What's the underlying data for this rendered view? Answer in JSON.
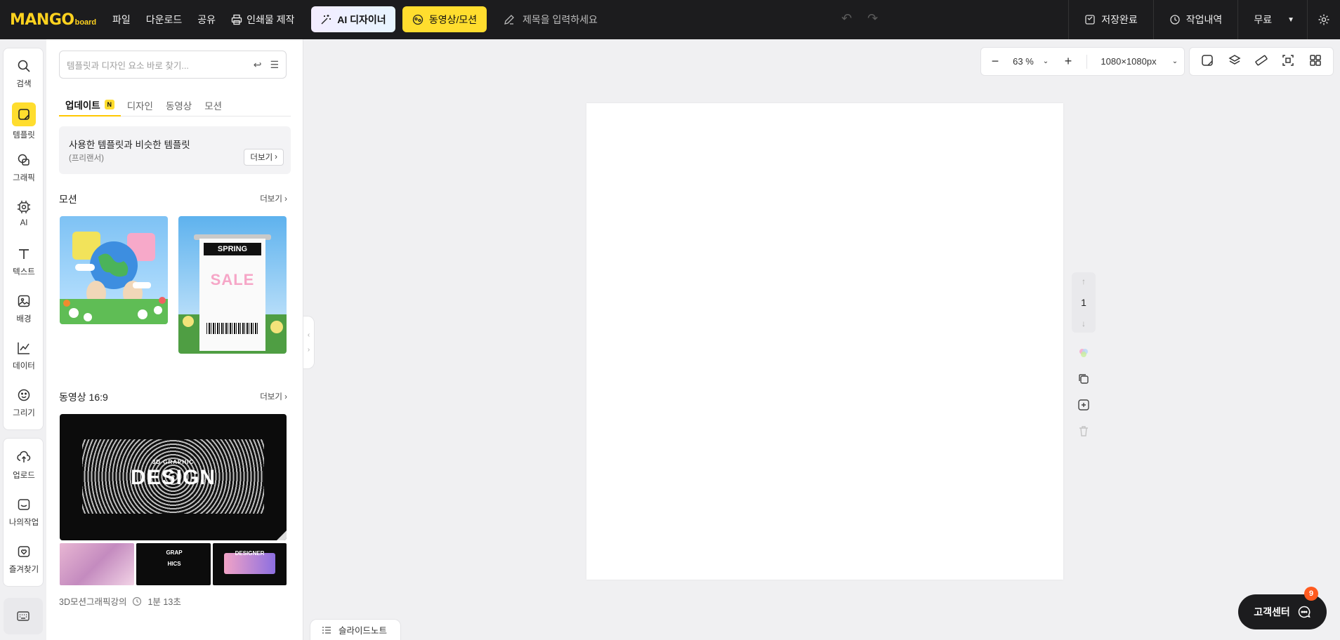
{
  "app": {
    "logo_main": "MANGO",
    "logo_sub": "board"
  },
  "topbar": {
    "menu": [
      "파일",
      "다운로드",
      "공유"
    ],
    "print": "인쇄물 제작",
    "ai_designer": "AI 디자이너",
    "video_motion": "동영상/모션",
    "title_placeholder": "제목을 입력하세요",
    "saved": "저장완료",
    "history": "작업내역",
    "plan": "무료"
  },
  "rail": {
    "items": [
      {
        "label": "검색",
        "icon": "search-icon"
      },
      {
        "label": "템플릿",
        "icon": "template-icon"
      },
      {
        "label": "그래픽",
        "icon": "graphic-icon"
      },
      {
        "label": "AI",
        "icon": "ai-icon"
      },
      {
        "label": "텍스트",
        "icon": "text-icon"
      },
      {
        "label": "배경",
        "icon": "background-icon"
      },
      {
        "label": "데이터",
        "icon": "chart-icon"
      },
      {
        "label": "그리기",
        "icon": "draw-icon"
      }
    ],
    "items2": [
      {
        "label": "업로드",
        "icon": "upload-icon"
      },
      {
        "label": "나의작업",
        "icon": "my-work-icon"
      },
      {
        "label": "즐겨찾기",
        "icon": "favorite-icon"
      }
    ]
  },
  "panel": {
    "search_placeholder": "템플릿과 디자인 요소 바로 찾기...",
    "tabs": [
      "업데이트",
      "디자인",
      "동영상",
      "모션"
    ],
    "tab_badge": "N",
    "similar_title": "사용한 템플릿과 비슷한 템플릿",
    "similar_sub": "(프리랜서)",
    "more": "더보기",
    "section_motion": "모션",
    "section_video": "동영상 16:9",
    "video_title_text": "DESIGN",
    "video_sub_text": "3D GRAPHIC",
    "receipt_text": "SPRING",
    "receipt_sale": "SALE",
    "thumb_small_2": "GRAP HICS",
    "thumb_small_3": "DESIGNER",
    "meta_title": "3D모션그래픽강의",
    "meta_duration": "1분 13초"
  },
  "canvas": {
    "zoom": "63 %",
    "size": "1080×1080px",
    "page": "1"
  },
  "footer": {
    "notes": "슬라이드노트",
    "support": "고객센터",
    "support_badge": "9"
  },
  "colors": {
    "accent": "#ffdd2e",
    "topbar": "#1c1c1e"
  }
}
